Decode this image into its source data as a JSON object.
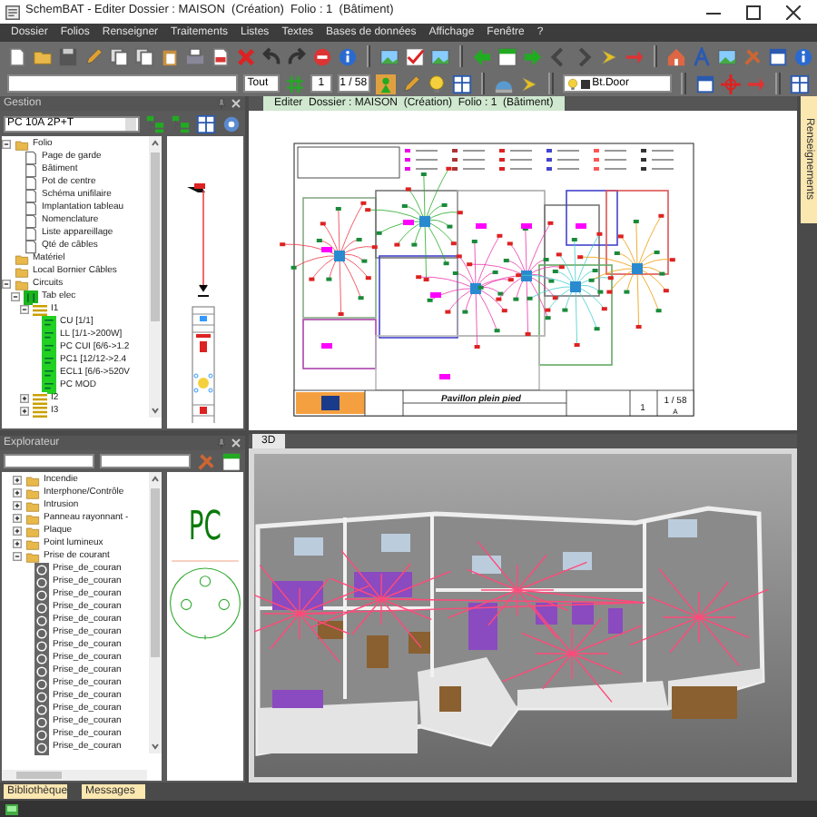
{
  "window": {
    "title": "SchemBAT - Editer Dossier : MAISON  (Création)  Folio : 1  (Bâtiment)"
  },
  "menu": [
    "Dossier",
    "Folios",
    "Renseigner",
    "Traitements",
    "Listes",
    "Textes",
    "Bases de données",
    "Affichage",
    "Fenêtre",
    "?"
  ],
  "toolbar2": {
    "filter": "Tout",
    "folio_number": "1",
    "folio_count": "1 / 58",
    "layer": "Bt.Door"
  },
  "gestion": {
    "title": "Gestion",
    "selector": "PC 10A 2P+T",
    "tree": [
      {
        "label": "Folio",
        "kind": "folder",
        "expanded": true,
        "children": [
          {
            "label": "Page de garde",
            "kind": "page"
          },
          {
            "label": "Bâtiment",
            "kind": "page"
          },
          {
            "label": "Pot de centre",
            "kind": "page"
          },
          {
            "label": "Schéma unifilaire",
            "kind": "page"
          },
          {
            "label": "Implantation tableau",
            "kind": "page"
          },
          {
            "label": "Nomenclature",
            "kind": "page"
          },
          {
            "label": "Liste appareillage",
            "kind": "page"
          },
          {
            "label": "Qté de câbles",
            "kind": "page"
          }
        ]
      },
      {
        "label": "Matériel",
        "kind": "folder"
      },
      {
        "label": "Local Bornier Câbles",
        "kind": "folder"
      },
      {
        "label": "Circuits",
        "kind": "folder",
        "expanded": true,
        "children": [
          {
            "label": "Tab elec",
            "kind": "panel",
            "expanded": true,
            "children": [
              {
                "label": "I1",
                "kind": "group",
                "expanded": true,
                "children": [
                  {
                    "label": "CU [1/1]",
                    "kind": "device"
                  },
                  {
                    "label": "LL [1/1->200W]",
                    "kind": "device"
                  },
                  {
                    "label": "PC CUI [6/6->1.2",
                    "kind": "device"
                  },
                  {
                    "label": "PC1 [12/12->2.4",
                    "kind": "device"
                  },
                  {
                    "label": "ECL1 [6/6->520V",
                    "kind": "device"
                  },
                  {
                    "label": "PC MOD",
                    "kind": "device"
                  }
                ]
              },
              {
                "label": "I2",
                "kind": "group",
                "expanded": false
              },
              {
                "label": "I3",
                "kind": "group",
                "expanded": false
              }
            ]
          }
        ]
      }
    ]
  },
  "document_tabs": [
    {
      "label": "Editer  Dossier : MAISON  (Création)  Folio : 1  (Bâtiment)",
      "selected": true
    }
  ],
  "side_tab": "Renseignements",
  "title_block": {
    "project": "Pavillon plein pied",
    "sheet": "1",
    "folio": "1 / 58",
    "revision": "A"
  },
  "view_tabs": [
    {
      "label": "3D",
      "selected": true
    }
  ],
  "explorateur": {
    "title": "Explorateur",
    "preview_label": "PC",
    "tree": [
      {
        "label": "Incendie",
        "kind": "folder",
        "expanded": false
      },
      {
        "label": "Interphone/Contrôle",
        "kind": "folder",
        "expanded": false
      },
      {
        "label": "Intrusion",
        "kind": "folder",
        "expanded": false
      },
      {
        "label": "Panneau rayonnant -",
        "kind": "folder",
        "expanded": false
      },
      {
        "label": "Plaque",
        "kind": "folder",
        "expanded": false
      },
      {
        "label": "Point lumineux",
        "kind": "folder",
        "expanded": false
      },
      {
        "label": "Prise de courant",
        "kind": "folder",
        "expanded": true,
        "children": [
          {
            "label": "Prise_de_couran",
            "kind": "symbol"
          },
          {
            "label": "Prise_de_couran",
            "kind": "symbol"
          },
          {
            "label": "Prise_de_couran",
            "kind": "symbol"
          },
          {
            "label": "Prise_de_couran",
            "kind": "symbol"
          },
          {
            "label": "Prise_de_couran",
            "kind": "symbol"
          },
          {
            "label": "Prise_de_couran",
            "kind": "symbol"
          },
          {
            "label": "Prise_de_couran",
            "kind": "symbol"
          },
          {
            "label": "Prise_de_couran",
            "kind": "symbol"
          },
          {
            "label": "Prise_de_couran",
            "kind": "symbol"
          },
          {
            "label": "Prise_de_couran",
            "kind": "symbol"
          },
          {
            "label": "Prise_de_couran",
            "kind": "symbol"
          },
          {
            "label": "Prise_de_couran",
            "kind": "symbol"
          },
          {
            "label": "Prise_de_couran",
            "kind": "symbol"
          },
          {
            "label": "Prise_de_couran",
            "kind": "symbol"
          },
          {
            "label": "Prise_de_couran",
            "kind": "symbol"
          }
        ]
      }
    ]
  },
  "bottom_tabs": [
    {
      "label": "Bibliothèque",
      "selected": false
    },
    {
      "label": "Messages",
      "selected": false
    }
  ]
}
